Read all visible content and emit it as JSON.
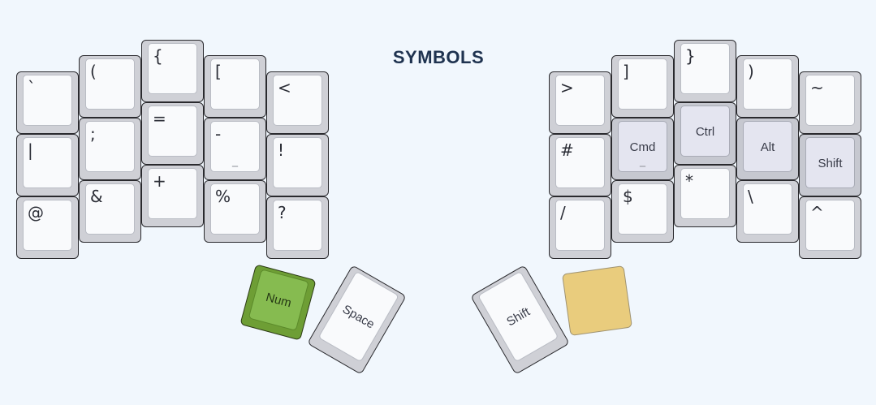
{
  "title": "SYMBOLS",
  "colors": {
    "background": "#f1f7fd",
    "key_base": "#cfd0d6",
    "key_cap": "#f9fafc",
    "modifier_cap": "#e4e5f0",
    "num_key": "#86bb50",
    "blank_thumb_key": "#e9cc7d",
    "title": "#1f3350"
  },
  "left_hand": {
    "row1": [
      "`",
      "(",
      "{",
      "[",
      "<"
    ],
    "row2": [
      "|",
      ";",
      "=",
      "-",
      "!"
    ],
    "row2_sub": {
      "3": "_"
    },
    "row3": [
      "@",
      "&",
      "+",
      "%",
      "?"
    ]
  },
  "right_hand": {
    "row1": [
      ">",
      "]",
      "}",
      ")",
      "~"
    ],
    "row2": [
      "#",
      "Cmd",
      "Ctrl",
      "Alt",
      "Shift"
    ],
    "row2_sub": {
      "1": "_"
    },
    "row3": [
      "/",
      "$",
      "*",
      "\\",
      "^"
    ]
  },
  "thumbs": {
    "left": [
      "Num",
      "Space"
    ],
    "right": [
      "Shift",
      ""
    ]
  }
}
